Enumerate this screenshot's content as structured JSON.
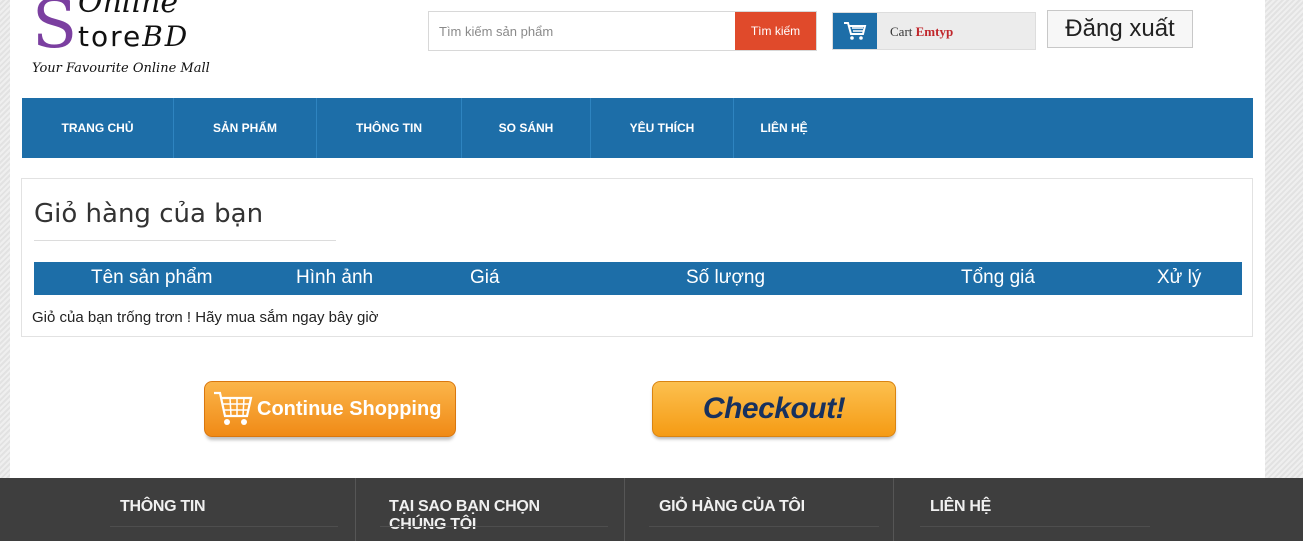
{
  "header": {
    "logo": {
      "line1": "Online",
      "line2": "tore",
      "line2_suffix": "BD",
      "tagline": "Your Favourite Online Mall"
    },
    "search": {
      "placeholder": "Tìm kiếm sản phẩm",
      "button": "Tìm kiếm"
    },
    "cart": {
      "label": "Cart",
      "status": "Emtyp"
    },
    "logout": "Đăng xuất"
  },
  "nav": [
    "TRANG CHỦ",
    "SẢN PHẨM",
    "THÔNG TIN",
    "SO SÁNH",
    "YÊU THÍCH",
    "LIÊN HỆ"
  ],
  "cart_page": {
    "title": "Giỏ hàng của bạn",
    "columns": [
      "Tên sản phẩm",
      "Hình ảnh",
      "Giá",
      "Số lượng",
      "Tổng giá",
      "Xử lý"
    ],
    "empty_message": "Giỏ của bạn trống trơn ! Hãy mua sắm ngay bây giờ"
  },
  "buttons": {
    "continue": "Continue Shopping",
    "checkout": "Checkout!"
  },
  "footer": {
    "headings": [
      "THÔNG TIN",
      "TẠI SAO BẠN CHỌN CHÚNG TÔI",
      "GIỎ HÀNG CỦA TÔI",
      "LIÊN HỆ"
    ]
  },
  "colors": {
    "primary": "#1d6ea8",
    "search_button": "#e04a2b",
    "logo": "#7b3fa0",
    "cart_status": "#c0262b",
    "footer": "#3e3e3e",
    "button_orange": "#f59b14"
  },
  "icons": [
    "shopping-cart-icon"
  ]
}
